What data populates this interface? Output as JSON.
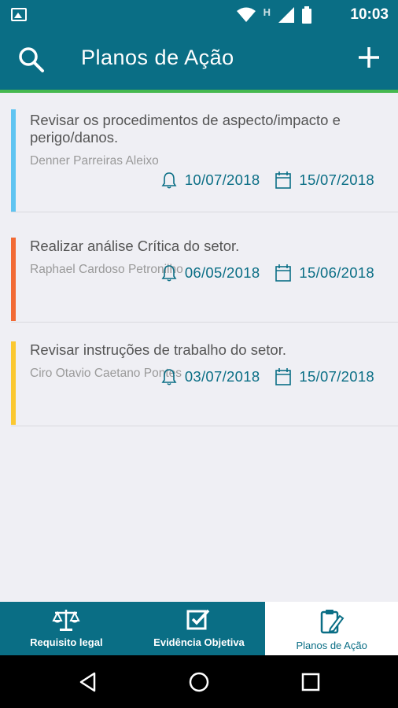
{
  "status_bar": {
    "time": "10:03",
    "network_letter": "H",
    "icons": [
      "image-icon",
      "wifi-icon",
      "signal-icon",
      "battery-icon"
    ]
  },
  "app_bar": {
    "title": "Planos de Ação",
    "icons": [
      "search-icon",
      "add-icon"
    ]
  },
  "colors": {
    "primary": "#0a6e85",
    "accent_green": "#46b84f",
    "background": "#efeff4",
    "stripes": [
      "#5fc4f1",
      "#f26a34",
      "#fbc830"
    ]
  },
  "plans": [
    {
      "title": "Revisar os procedimentos de aspecto/impacto e perigo/danos.",
      "owner": "Denner Parreiras Aleixo",
      "alert_date": "10/07/2018",
      "due_date": "15/07/2018"
    },
    {
      "title": "Realizar análise Crítica do setor.",
      "owner": "Raphael Cardoso Petronilho",
      "alert_date": "06/05/2018",
      "due_date": "15/06/2018"
    },
    {
      "title": "Revisar instruções de trabalho do setor.",
      "owner": "Ciro Otavio Caetano Pontes",
      "alert_date": "03/07/2018",
      "due_date": "15/07/2018"
    }
  ],
  "bottom_nav": {
    "items": [
      {
        "label": "Requisito legal",
        "icon": "scale-icon"
      },
      {
        "label": "Evidência Objetiva",
        "icon": "checkbox-icon"
      },
      {
        "label": "Planos de Ação",
        "icon": "clipboard-edit-icon",
        "active": true
      }
    ]
  },
  "system_nav": [
    "back-icon",
    "home-icon",
    "recents-icon"
  ]
}
